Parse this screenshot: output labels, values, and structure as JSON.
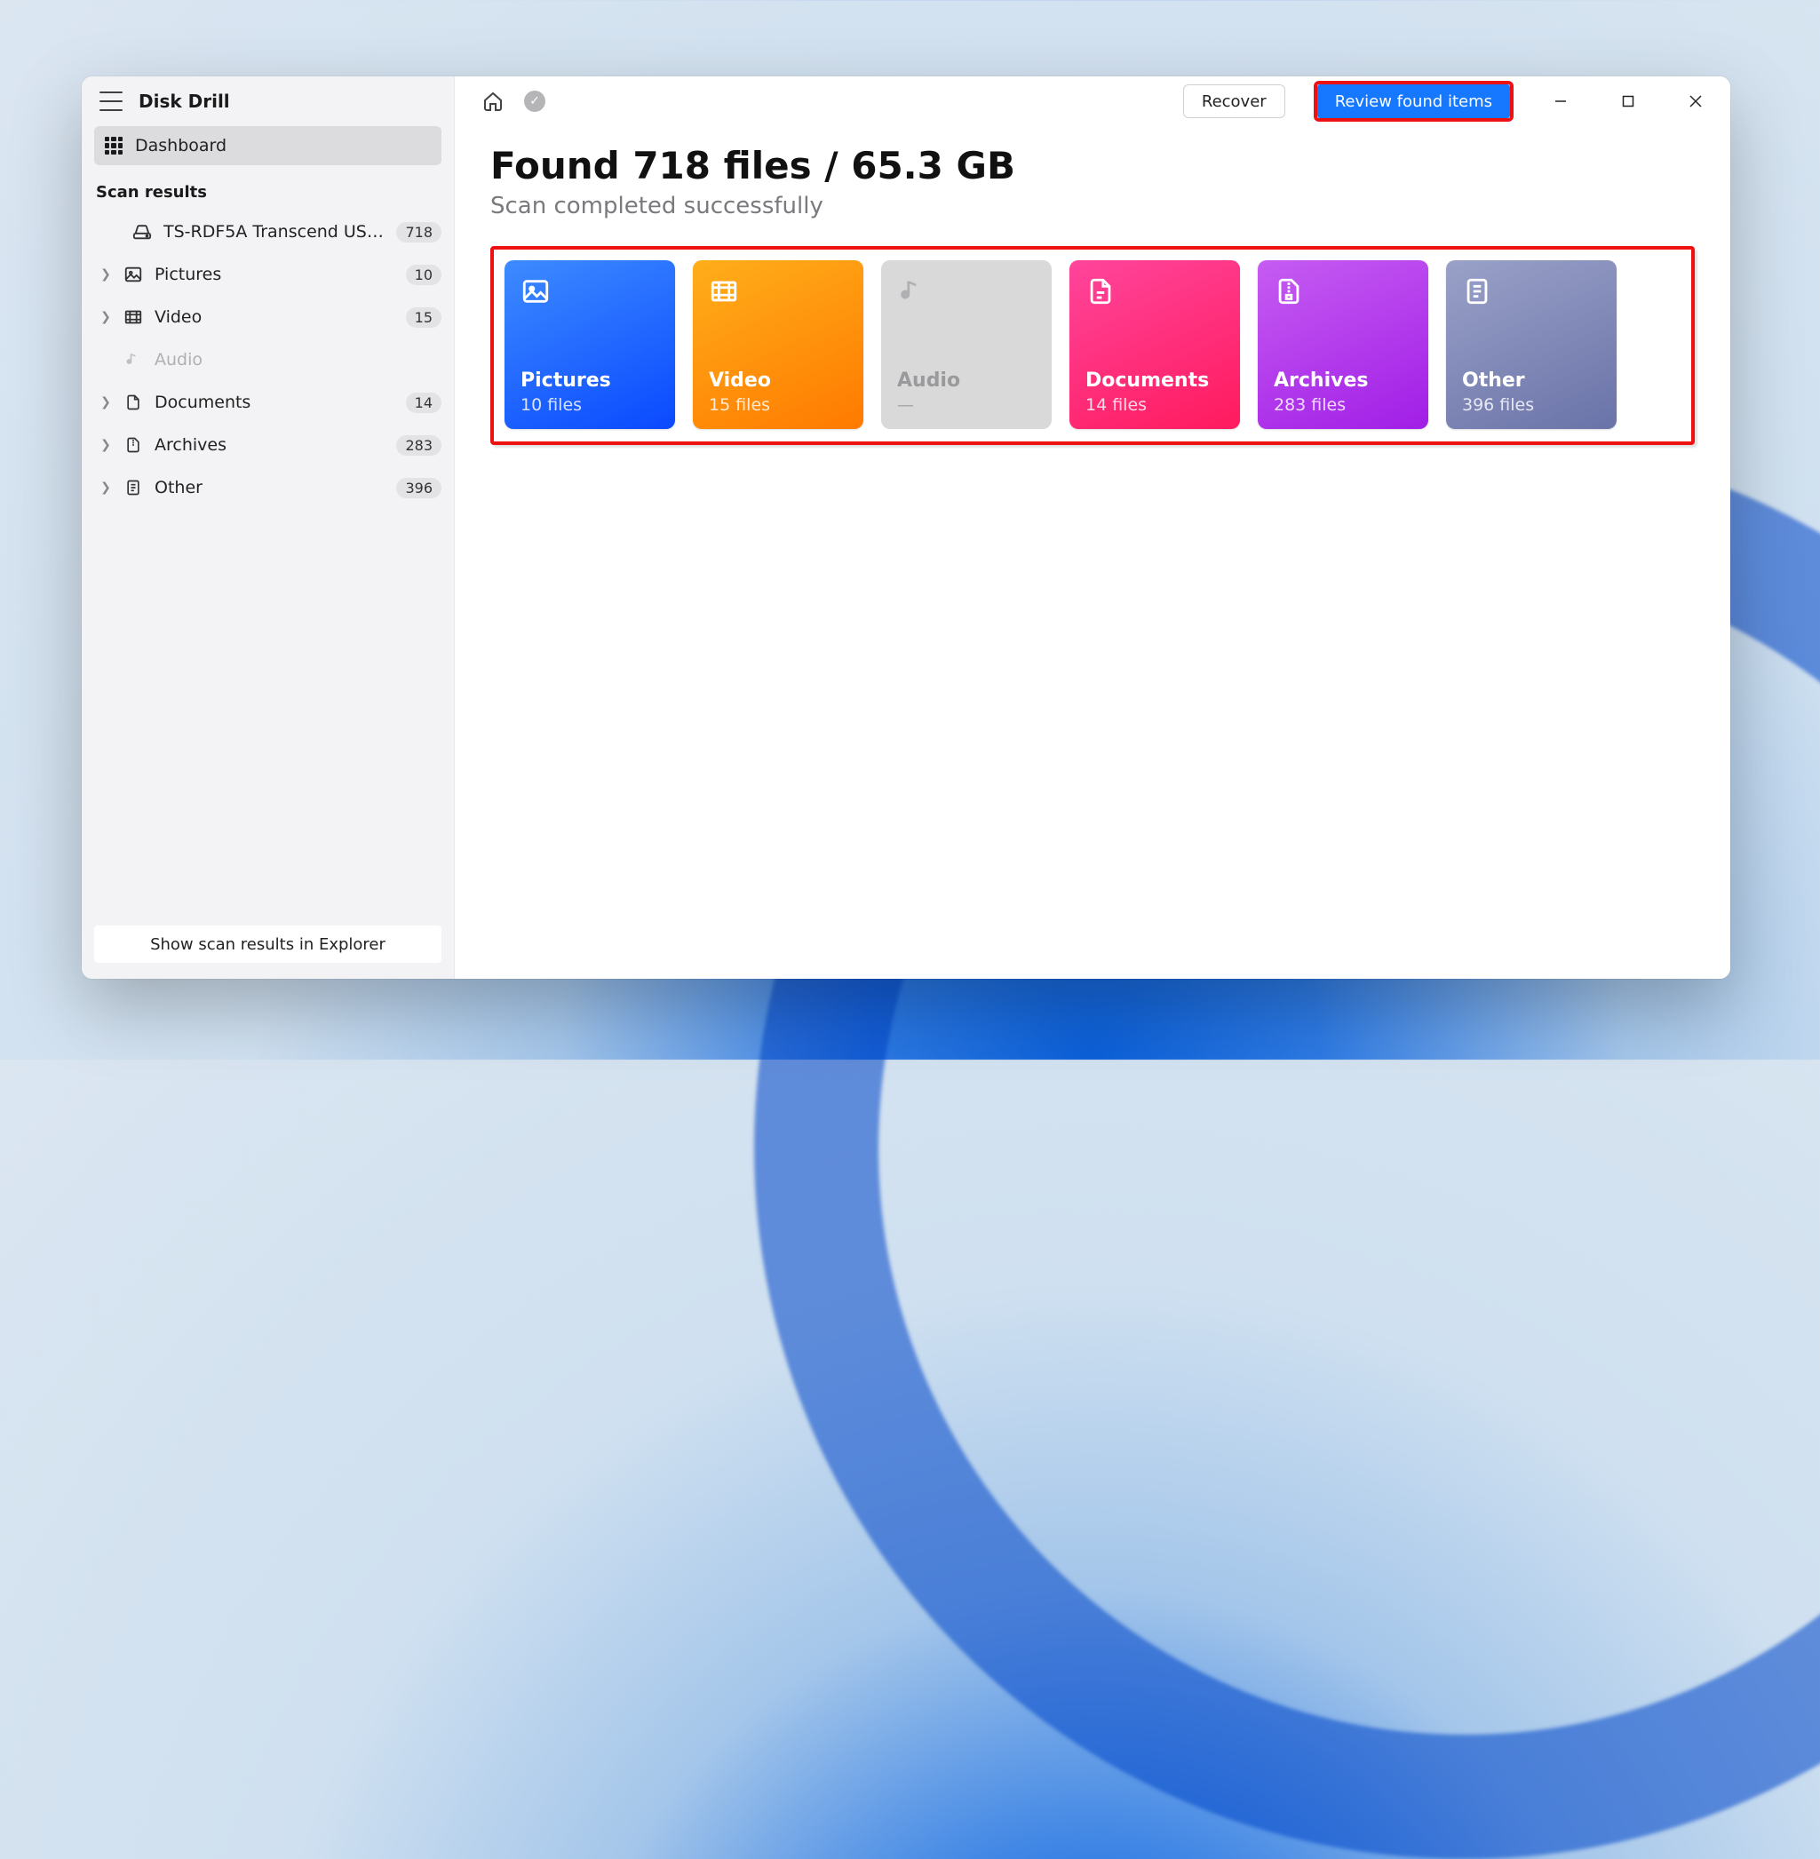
{
  "app": {
    "title": "Disk Drill"
  },
  "sidebar": {
    "dashboard_label": "Dashboard",
    "section_label": "Scan results",
    "device": {
      "label": "TS-RDF5A Transcend US…",
      "count": "718"
    },
    "items": [
      {
        "label": "Pictures",
        "count": "10"
      },
      {
        "label": "Video",
        "count": "15"
      },
      {
        "label": "Audio",
        "count": ""
      },
      {
        "label": "Documents",
        "count": "14"
      },
      {
        "label": "Archives",
        "count": "283"
      },
      {
        "label": "Other",
        "count": "396"
      }
    ],
    "footer_button": "Show scan results in Explorer"
  },
  "header": {
    "recover_label": "Recover",
    "review_label": "Review found items"
  },
  "main": {
    "headline": "Found 718 files / 65.3 GB",
    "subhead": "Scan completed successfully",
    "cards": {
      "pictures": {
        "title": "Pictures",
        "sub": "10 files"
      },
      "video": {
        "title": "Video",
        "sub": "15 files"
      },
      "audio": {
        "title": "Audio",
        "sub": "—"
      },
      "documents": {
        "title": "Documents",
        "sub": "14 files"
      },
      "archives": {
        "title": "Archives",
        "sub": "283 files"
      },
      "other": {
        "title": "Other",
        "sub": "396 files"
      }
    }
  }
}
